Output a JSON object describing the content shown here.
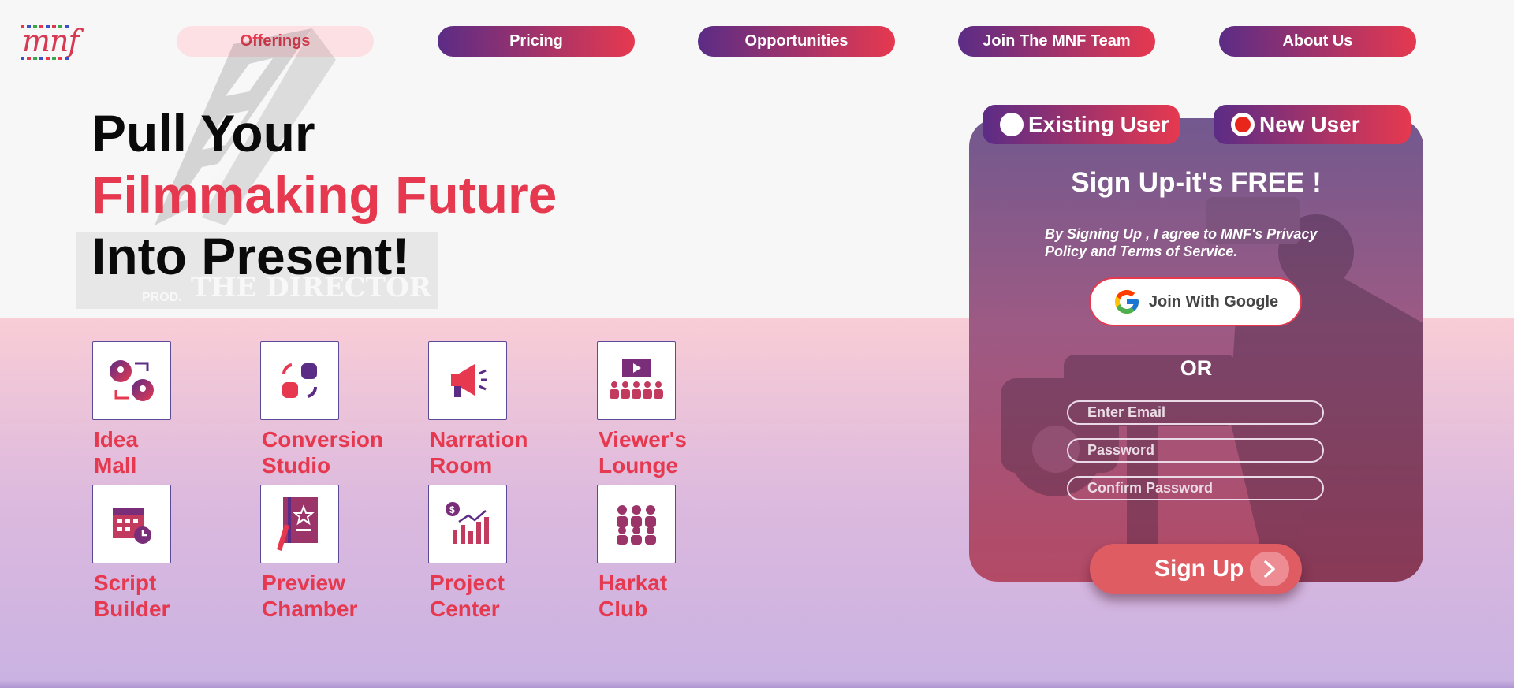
{
  "brand": {
    "logo_text": "mnf"
  },
  "colors": {
    "accent": "#e6394f",
    "gradient_start": "#5b2c86",
    "gradient_end": "#e6394f",
    "active_nav_bg": "#fde0e4"
  },
  "nav": {
    "items": [
      {
        "label": "Offerings",
        "active": true
      },
      {
        "label": "Pricing",
        "active": false
      },
      {
        "label": "Opportunities",
        "active": false
      },
      {
        "label": "Join The MNF Team",
        "active": false
      },
      {
        "label": "About Us",
        "active": false
      }
    ]
  },
  "hero": {
    "line1": "Pull Your",
    "line2": "Filmmaking Future",
    "line3": "Into Present!",
    "decoration_prod": "PROD.",
    "decoration_title": "THE DIRECTOR"
  },
  "features": [
    {
      "line1": "Idea",
      "line2": "Mall",
      "icon": "idea-exchange-icon"
    },
    {
      "line1": "Conversion",
      "line2": "Studio",
      "icon": "conversion-icon"
    },
    {
      "line1": "Narration",
      "line2": "Room",
      "icon": "megaphone-icon"
    },
    {
      "line1": "Viewer's",
      "line2": "Lounge",
      "icon": "audience-screen-icon"
    },
    {
      "line1": "Script",
      "line2": "Builder",
      "icon": "calendar-clock-icon"
    },
    {
      "line1": "Preview",
      "line2": "Chamber",
      "icon": "notebook-star-icon"
    },
    {
      "line1": "Project",
      "line2": "Center",
      "icon": "growth-chart-icon"
    },
    {
      "line1": "Harkat",
      "line2": "Club",
      "icon": "group-icon"
    }
  ],
  "auth": {
    "existing_user": "Existing User",
    "new_user": "New User",
    "selected": "new_user",
    "title": "Sign Up-it's FREE !",
    "note": "By Signing Up , I agree to MNF's Privacy Policy and Terms of Service.",
    "google_button": "Join With Google",
    "or": "OR",
    "email_placeholder": "Enter Email",
    "password_placeholder": "Password",
    "confirm_placeholder": "Confirm Password",
    "signup_button": "Sign Up"
  }
}
